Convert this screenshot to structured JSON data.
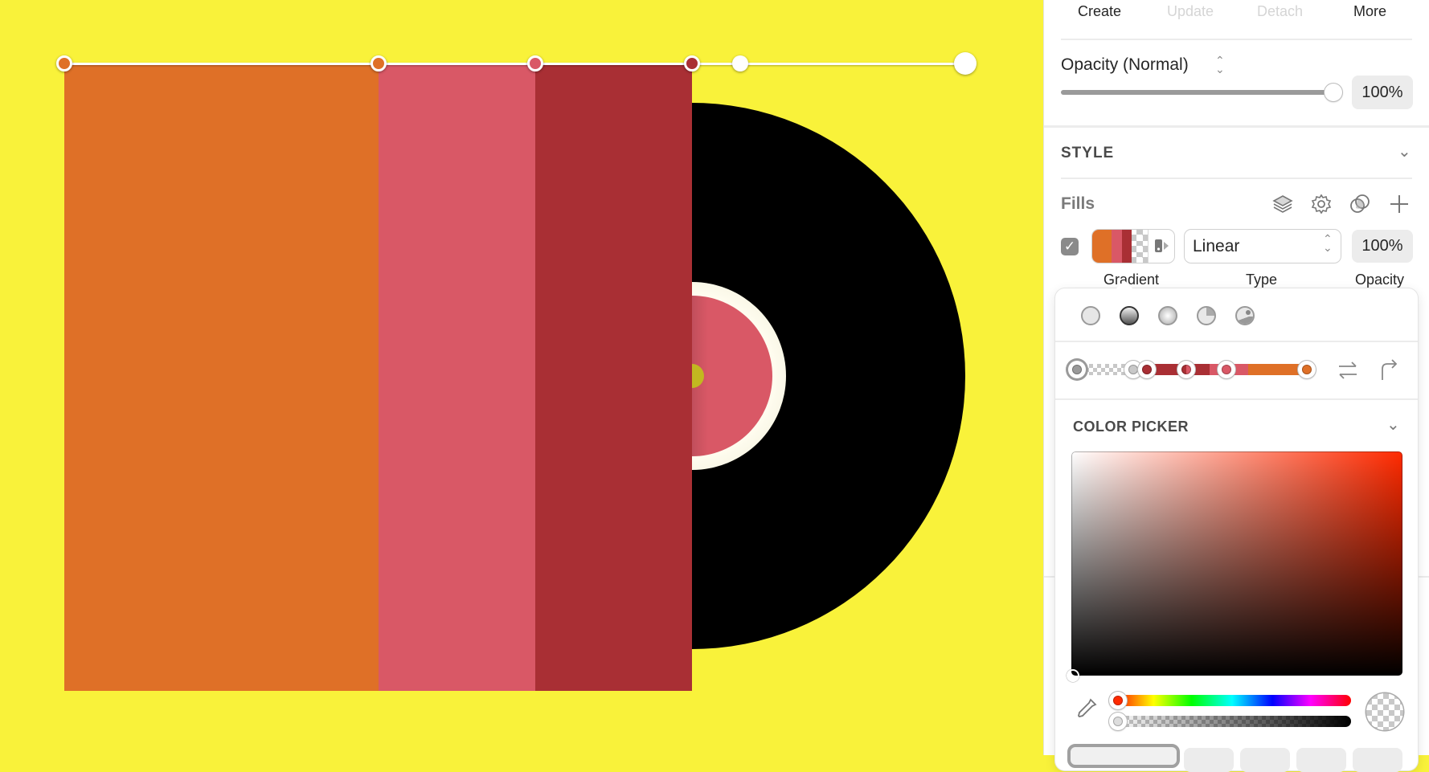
{
  "toolbar": {
    "create": "Create",
    "update": "Update",
    "detach": "Detach",
    "more": "More"
  },
  "opacity": {
    "label": "Opacity (Normal)",
    "value_text": "100%",
    "value": 1.0
  },
  "style": {
    "title": "STYLE"
  },
  "fills": {
    "title": "Fills",
    "enabled": true,
    "fill_kind": "Gradient",
    "type_value": "Linear",
    "opacity_text": "100%",
    "labels": {
      "gradient": "Gradient",
      "type": "Type",
      "opacity": "Opacity"
    }
  },
  "gradient_editor": {
    "fill_types": [
      "solid-fill",
      "linear-gradient",
      "radial-gradient",
      "angular-gradient",
      "pattern-image"
    ],
    "selected_fill_type": "linear-gradient",
    "stops": [
      {
        "position": 0.0,
        "color": "#00000000"
      },
      {
        "position": 0.25,
        "color": "#c0c0c0"
      },
      {
        "position": 0.3,
        "color": "#a92f34"
      },
      {
        "position": 0.47,
        "color": "#a92f34"
      },
      {
        "position": 0.65,
        "color": "#d95866"
      },
      {
        "position": 1.0,
        "color": "#df7027"
      }
    ]
  },
  "color_picker": {
    "title": "COLOR PICKER",
    "hue_color": "#ff2a00",
    "alpha": 0.0
  },
  "canvas": {
    "background": "#f9f23a",
    "bands": [
      {
        "color": "#df7027"
      },
      {
        "color": "#d95866"
      },
      {
        "color": "#a92f34"
      }
    ],
    "record_color": "#000000",
    "label_ring_color": "#fbf7e8",
    "label_color": "#d95866",
    "spindle_color": "#c2b820"
  }
}
